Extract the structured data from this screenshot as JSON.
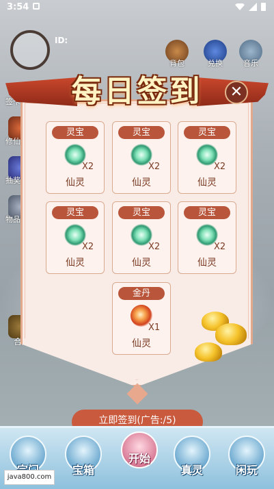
{
  "status_bar": {
    "time": "3:54"
  },
  "header": {
    "id_label": "ID:",
    "top_buttons": [
      {
        "label": "背包",
        "icon": "backpack-icon"
      },
      {
        "label": "兑换",
        "icon": "exchange-icon"
      },
      {
        "label": "音乐",
        "icon": "music-icon"
      }
    ]
  },
  "sidebar": {
    "items": [
      {
        "label": "签卡"
      },
      {
        "label": "修仙玩"
      },
      {
        "label": "抽奖"
      },
      {
        "label": "物品记"
      },
      {
        "label": "合成"
      }
    ]
  },
  "dialog": {
    "title": "每日签到",
    "close_symbol": "✕",
    "cards": [
      {
        "tag": "灵宝",
        "qty": "X2",
        "name": "仙灵"
      },
      {
        "tag": "灵宝",
        "qty": "X2",
        "name": "仙灵"
      },
      {
        "tag": "灵宝",
        "qty": "X2",
        "name": "仙灵"
      },
      {
        "tag": "灵宝",
        "qty": "X2",
        "name": "仙灵"
      },
      {
        "tag": "灵宝",
        "qty": "X2",
        "name": "仙灵"
      },
      {
        "tag": "灵宝",
        "qty": "X2",
        "name": "仙灵"
      },
      {
        "tag": "金丹",
        "qty": "X1",
        "name": "仙灵"
      }
    ],
    "cta_label": "立即签到(广告:/5)"
  },
  "bottom_nav": {
    "items": [
      {
        "label": "宗门"
      },
      {
        "label": "宝箱"
      },
      {
        "label": "开始"
      },
      {
        "label": "真灵"
      },
      {
        "label": "闲玩"
      }
    ]
  },
  "watermark": "java800.com"
}
